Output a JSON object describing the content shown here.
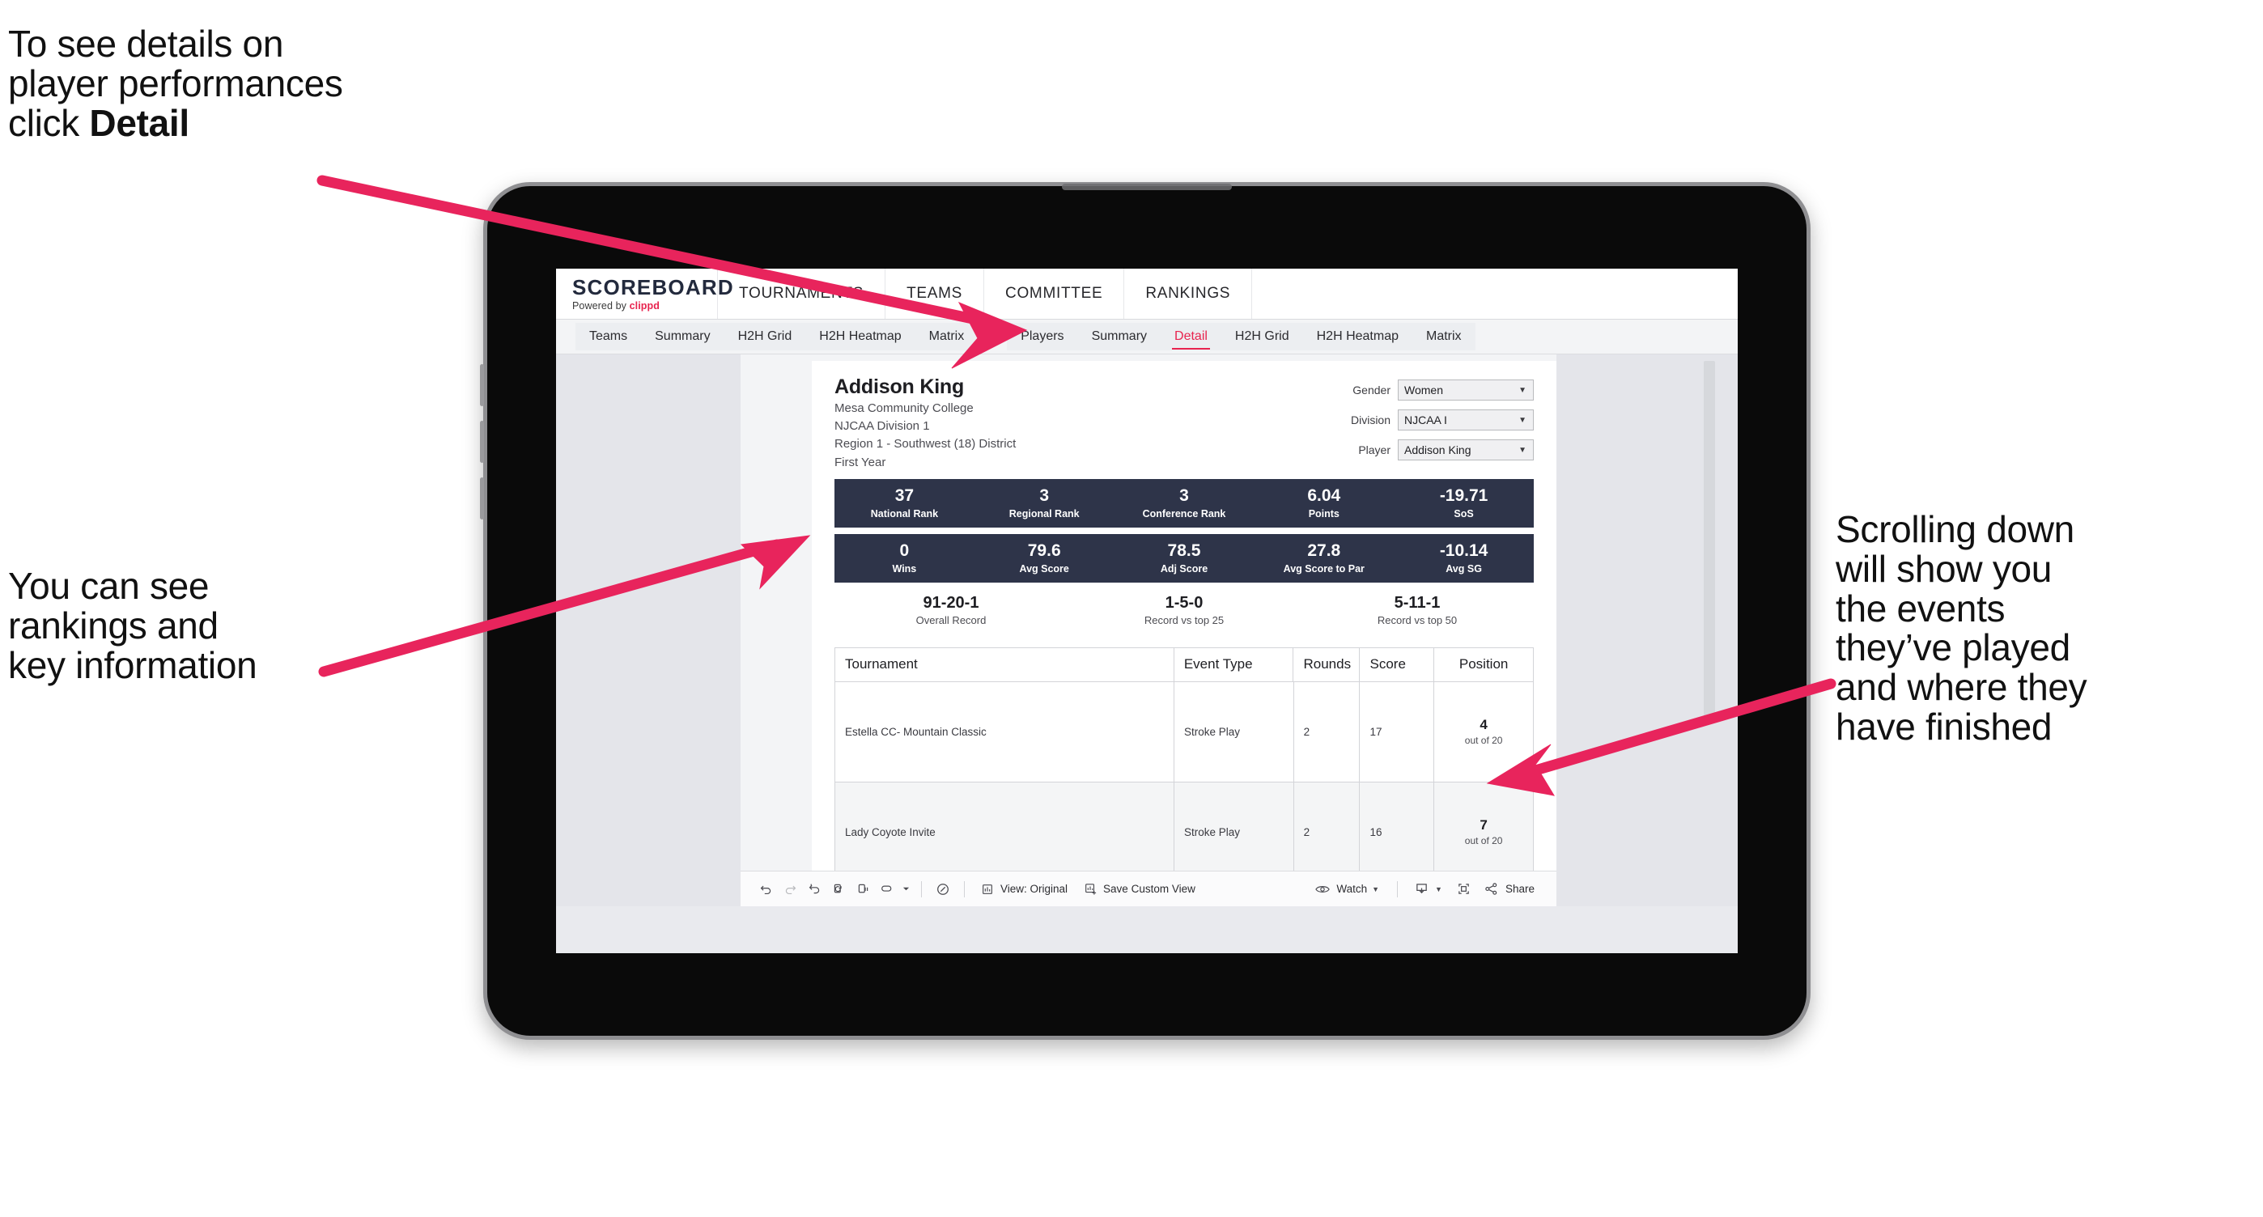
{
  "annotations": {
    "top_left": "To see details on\nplayer performances\nclick ",
    "top_left_bold": "Detail",
    "bottom_left": "You can see\nrankings and\nkey information",
    "right": "Scrolling down\nwill show you\nthe events\nthey’ve played\nand where they\nhave finished",
    "arrow_color": "#e8245c"
  },
  "app": {
    "brand": {
      "title": "SCOREBOARD",
      "powered_prefix": "Powered by ",
      "powered_name": "clippd"
    },
    "top_nav": [
      "TOURNAMENTS",
      "TEAMS",
      "COMMITTEE",
      "RANKINGS"
    ],
    "tab_group_teams": [
      "Teams",
      "Summary",
      "H2H Grid",
      "H2H Heatmap",
      "Matrix"
    ],
    "tab_group_players": [
      "Players",
      "Summary",
      "Detail",
      "H2H Grid",
      "H2H Heatmap",
      "Matrix"
    ],
    "active_tab": "Detail",
    "accent_color": "#e8244f",
    "stat_bar_color": "#2e3449"
  },
  "player": {
    "name": "Addison King",
    "school": "Mesa Community College",
    "division": "NJCAA Division 1",
    "region": "Region 1 - Southwest (18) District",
    "year": "First Year"
  },
  "filters": [
    {
      "label": "Gender",
      "value": "Women"
    },
    {
      "label": "Division",
      "value": "NJCAA I"
    },
    {
      "label": "Player",
      "value": "Addison King"
    }
  ],
  "stats_row_1": [
    {
      "value": "37",
      "label": "National Rank"
    },
    {
      "value": "3",
      "label": "Regional Rank"
    },
    {
      "value": "3",
      "label": "Conference Rank"
    },
    {
      "value": "6.04",
      "label": "Points"
    },
    {
      "value": "-19.71",
      "label": "SoS"
    }
  ],
  "stats_row_2": [
    {
      "value": "0",
      "label": "Wins"
    },
    {
      "value": "79.6",
      "label": "Avg Score"
    },
    {
      "value": "78.5",
      "label": "Adj Score"
    },
    {
      "value": "27.8",
      "label": "Avg Score to Par"
    },
    {
      "value": "-10.14",
      "label": "Avg SG"
    }
  ],
  "records": [
    {
      "value": "91-20-1",
      "label": "Overall Record"
    },
    {
      "value": "1-5-0",
      "label": "Record vs top 25"
    },
    {
      "value": "5-11-1",
      "label": "Record vs top 50"
    }
  ],
  "table": {
    "headers": [
      "Tournament",
      "Event Type",
      "Rounds",
      "Score",
      "Position"
    ],
    "rows": [
      {
        "tournament": "Estella CC- Mountain Classic",
        "event_type": "Stroke Play",
        "rounds": "2",
        "score": "17",
        "position_value": "4",
        "position_sub": "out of 20"
      },
      {
        "tournament": "Lady Coyote Invite",
        "event_type": "Stroke Play",
        "rounds": "2",
        "score": "16",
        "position_value": "7",
        "position_sub": "out of 20"
      }
    ]
  },
  "toolbar": {
    "view_label": "View: Original",
    "save_label": "Save Custom View",
    "watch_label": "Watch",
    "share_label": "Share"
  }
}
